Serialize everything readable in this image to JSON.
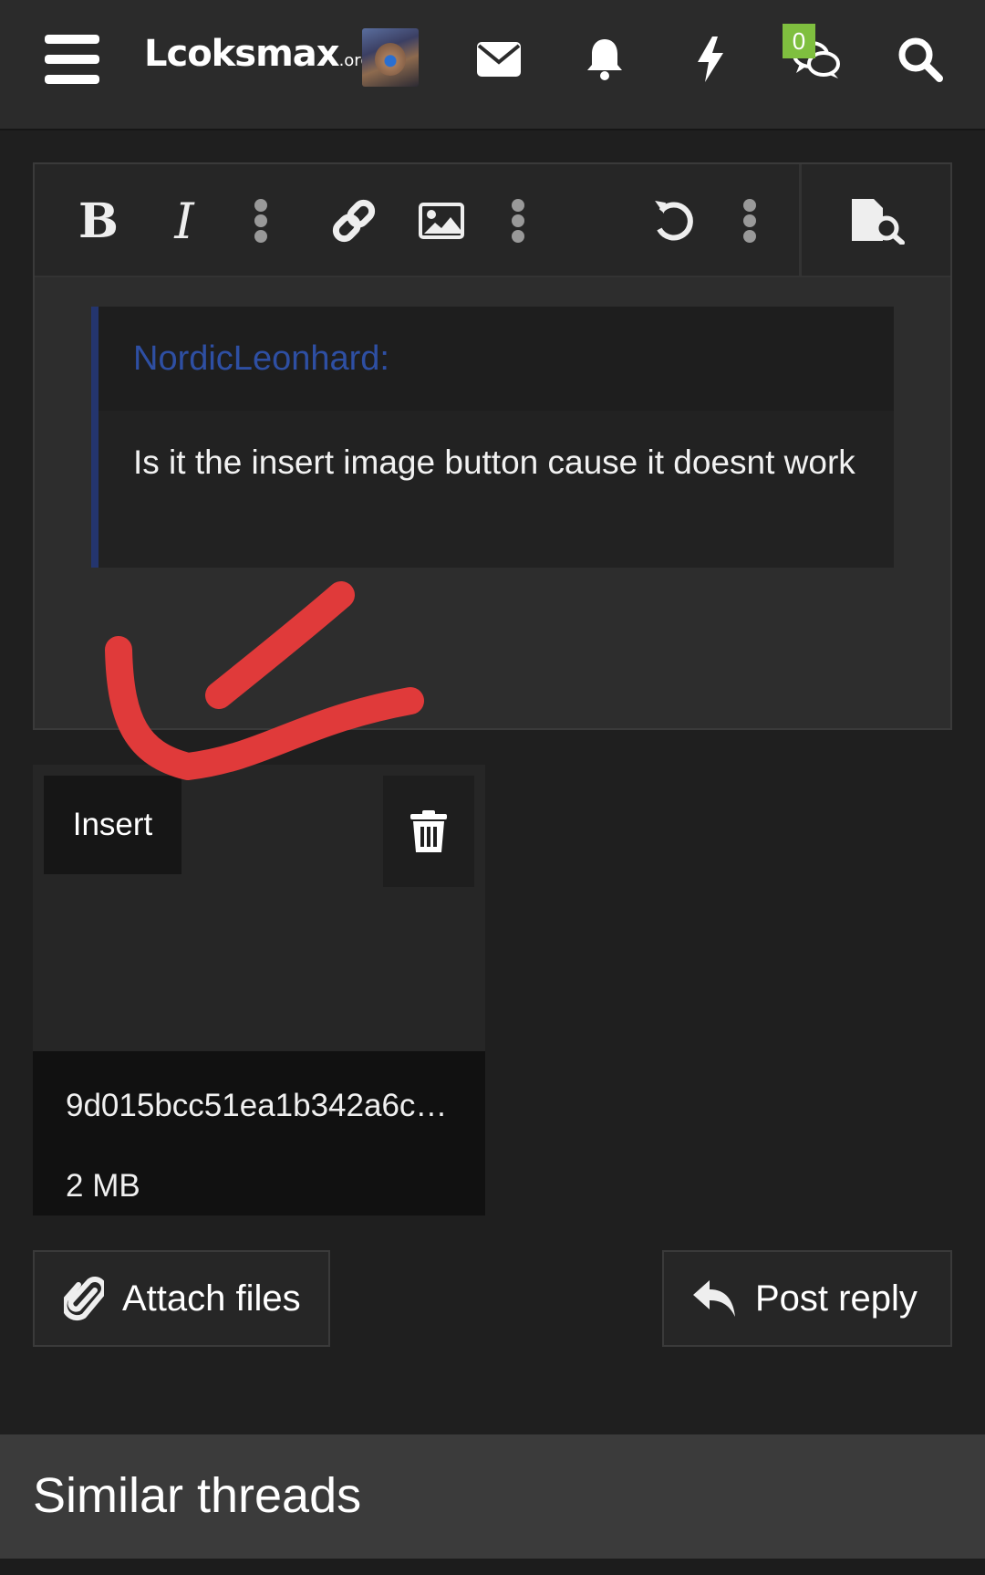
{
  "header": {
    "logo_main": "Lcoksmax",
    "logo_suffix": ".org",
    "conversations_badge": "0",
    "icons": [
      "menu-icon",
      "envelope-icon",
      "bell-icon",
      "lightning-icon",
      "conversations-icon",
      "search-icon"
    ]
  },
  "editor": {
    "toolbar": [
      "bold",
      "italic",
      "more-text",
      "link",
      "image",
      "more-insert",
      "undo",
      "more-options",
      "preview"
    ],
    "bold_label": "B",
    "italic_label": "I",
    "quote": {
      "author": "NordicLeonhard:",
      "body": "Is it the insert image button cause it doesnt work"
    }
  },
  "attachment": {
    "insert_label": "Insert",
    "file_name": "9d015bcc51ea1b342a6c…",
    "file_size": "2 MB"
  },
  "actions": {
    "attach_label": "Attach files",
    "reply_label": "Post reply"
  },
  "similar": {
    "title": "Similar threads"
  },
  "colors": {
    "background": "#1f1f1f",
    "topbar": "#2b2b2b",
    "quote_accent": "#24356e",
    "quote_author": "#2e4fa3",
    "badge": "#7fbf3f",
    "annotation": "#e03a3a"
  }
}
